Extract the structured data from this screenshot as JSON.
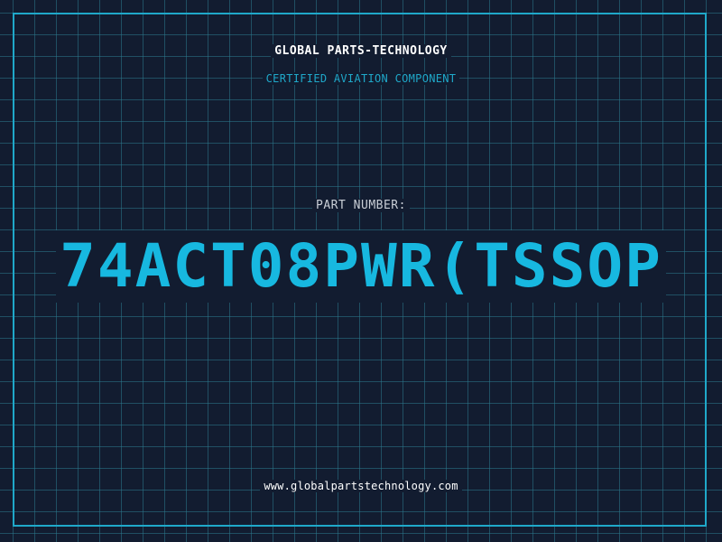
{
  "header": {
    "company_name": "GLOBAL PARTS-TECHNOLOGY",
    "subtitle": "CERTIFIED AVIATION COMPONENT"
  },
  "part": {
    "label": "PART NUMBER:",
    "number": "74ACT08PWR(TSSOP"
  },
  "footer": {
    "website": "www.globalpartstechnology.com"
  },
  "colors": {
    "background": "#121c30",
    "grid": "#2c788c",
    "accent": "#1fa8c9",
    "part_number": "#17b8e0",
    "text": "#ffffff"
  }
}
